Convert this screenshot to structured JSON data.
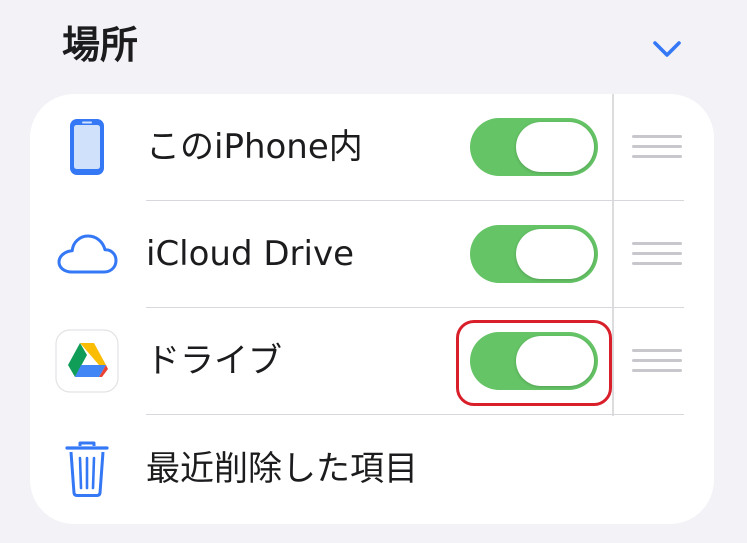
{
  "section": {
    "title": "場所"
  },
  "locations": [
    {
      "label": "このiPhone内",
      "icon": "iphone-icon",
      "enabled": true
    },
    {
      "label": "iCloud Drive",
      "icon": "icloud-icon",
      "enabled": true
    },
    {
      "label": "ドライブ",
      "icon": "google-drive-icon",
      "enabled": true
    },
    {
      "label": "最近削除した項目",
      "icon": "trash-icon"
    }
  ],
  "colors": {
    "accent": "#3478f6",
    "toggle_on": "#65c466",
    "highlight": "#d81f2a",
    "background": "#f2f2f7"
  }
}
